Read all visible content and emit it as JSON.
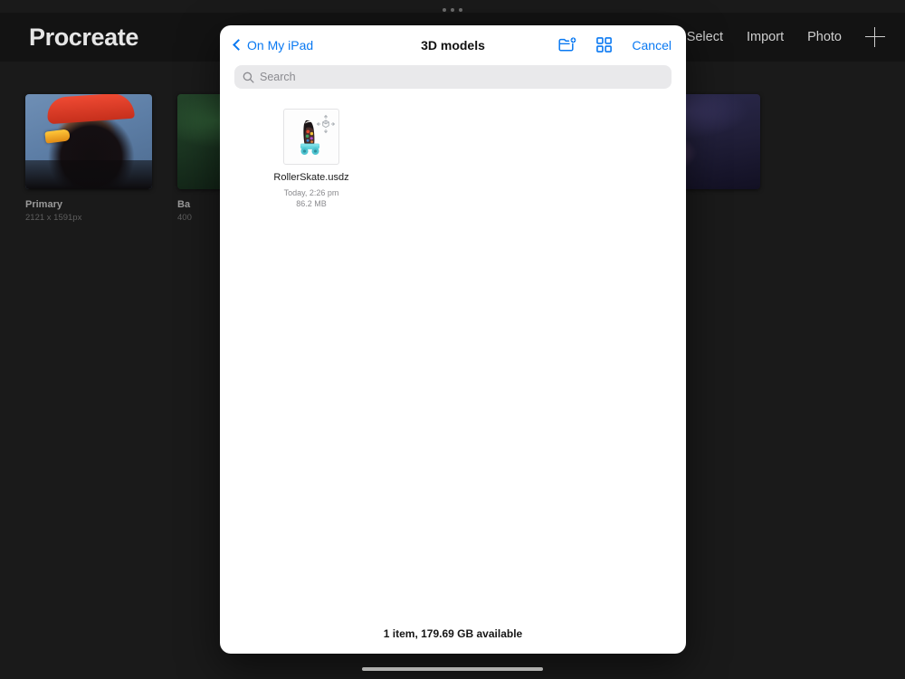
{
  "app": {
    "title": "Procreate",
    "actions": [
      {
        "label": "Select",
        "name": "select-button"
      },
      {
        "label": "Import",
        "name": "import-button"
      },
      {
        "label": "Photo",
        "name": "photo-button"
      }
    ],
    "add_icon": "plus-icon",
    "multitask_icon": "multitasking-dots-icon",
    "artworks": [
      {
        "name": "Primary",
        "dimensions": "2121 x 1591px"
      },
      {
        "name": "Ba",
        "dimensions": "400"
      },
      {
        "name": "",
        "dimensions": ""
      }
    ]
  },
  "picker": {
    "back_label": "On My iPad",
    "back_icon": "chevron-left-icon",
    "title": "3D models",
    "new_folder_icon": "new-folder-icon",
    "grid_view_icon": "grid-view-icon",
    "cancel_label": "Cancel",
    "search": {
      "placeholder": "Search",
      "value": "",
      "icon": "search-icon"
    },
    "files": [
      {
        "name": "RollerSkate.usdz",
        "date": "Today, 2:26 pm",
        "size": "86.2 MB",
        "thumbnail_icon": "usdz-3d-model-thumbnail",
        "badge_icon": "ar-3d-object-badge-icon"
      }
    ],
    "footer": "1 item, 179.69 GB available"
  },
  "colors": {
    "accent_blue": "#0a79f2",
    "sheet_background": "#ffffff",
    "app_background": "#1a1a1a",
    "search_field": "#e9e9eb"
  }
}
